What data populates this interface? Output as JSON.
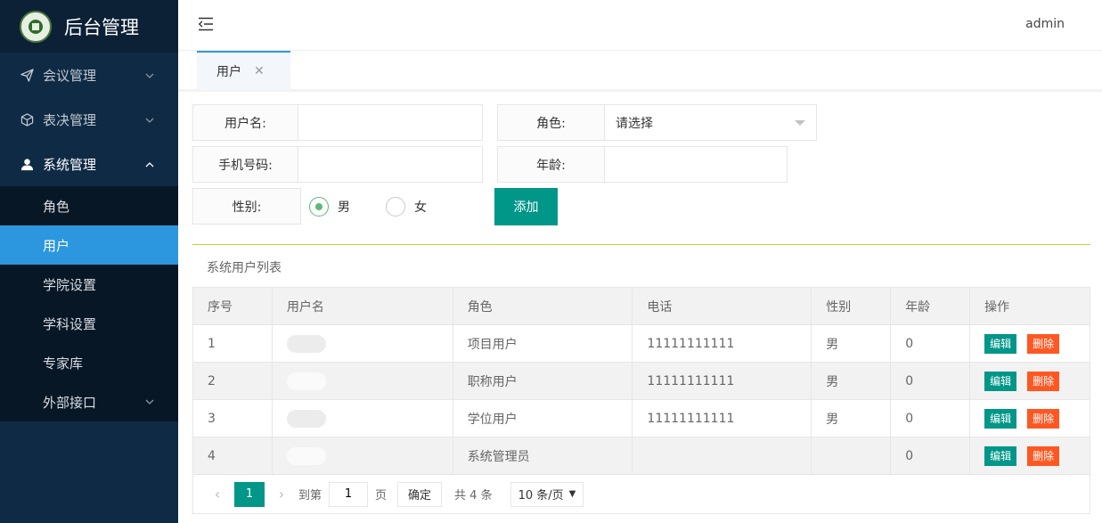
{
  "sidebar": {
    "title": "后台管理",
    "menus": [
      {
        "label": "会议管理",
        "icon": "paper-plane-icon"
      },
      {
        "label": "表决管理",
        "icon": "cube-icon"
      },
      {
        "label": "系统管理",
        "icon": "user-icon"
      }
    ],
    "submenu": [
      {
        "label": "角色"
      },
      {
        "label": "用户"
      },
      {
        "label": "学院设置"
      },
      {
        "label": "学科设置"
      },
      {
        "label": "专家库"
      },
      {
        "label": "外部接口"
      }
    ],
    "accent_color": "#2c97de"
  },
  "header": {
    "user": "admin"
  },
  "tabs": [
    {
      "label": "用户",
      "close": "✕"
    }
  ],
  "form": {
    "username_label": "用户名:",
    "username_value": "",
    "role_label": "角色:",
    "role_selected": "请选择",
    "phone_label": "手机号码:",
    "phone_value": "",
    "age_label": "年龄:",
    "age_value": "",
    "gender_label": "性别:",
    "gender_options": [
      "男",
      "女"
    ],
    "gender_selected": "男",
    "add_button": "添加"
  },
  "list": {
    "title": "系统用户列表",
    "columns": [
      "序号",
      "用户名",
      "角色",
      "电话",
      "性别",
      "年龄",
      "操作"
    ],
    "rows": [
      {
        "no": "1",
        "role": "项目用户",
        "phone": "11111111111",
        "gender": "男",
        "age": "0"
      },
      {
        "no": "2",
        "role": "职称用户",
        "phone": "11111111111",
        "gender": "男",
        "age": "0"
      },
      {
        "no": "3",
        "role": "学位用户",
        "phone": "11111111111",
        "gender": "男",
        "age": "0"
      },
      {
        "no": "4",
        "role": "系统管理员",
        "phone": "",
        "gender": "",
        "age": "0"
      }
    ],
    "edit_label": "编辑",
    "delete_label": "删除"
  },
  "pagination": {
    "current": "1",
    "goto_label": "到第",
    "goto_value": "1",
    "page_label": "页",
    "confirm": "确定",
    "total": "共 4 条",
    "page_size": "10 条/页"
  },
  "colors": {
    "primary": "#009688",
    "danger": "#ff5722",
    "radio_on": "#5fb878"
  }
}
